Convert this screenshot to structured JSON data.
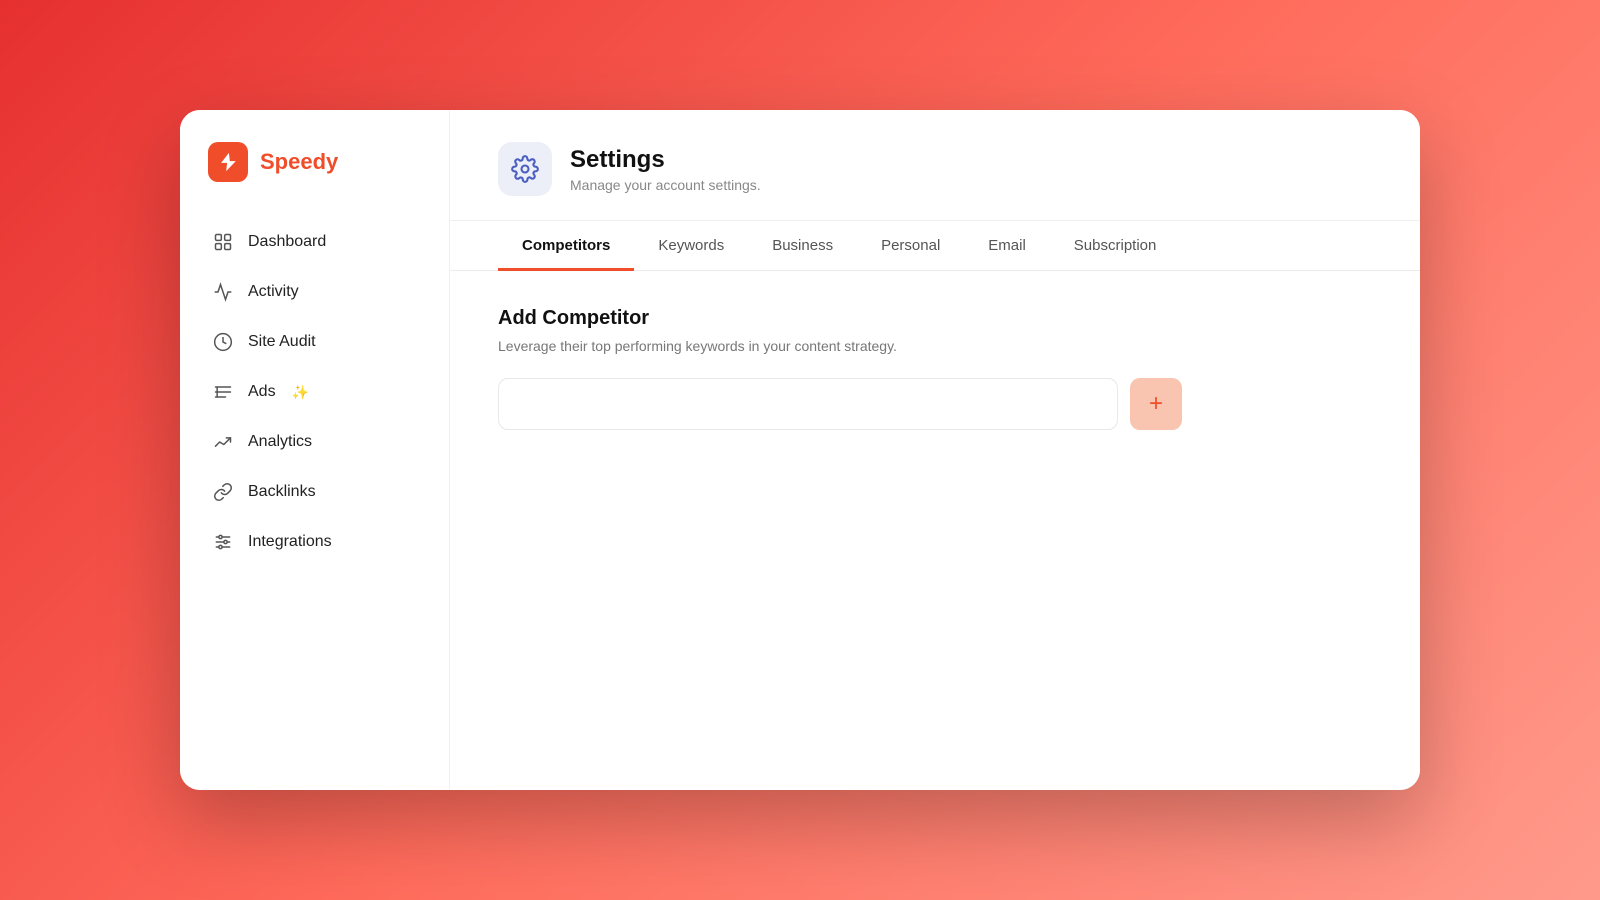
{
  "app": {
    "name": "Speedy",
    "logo_icon": "🚀"
  },
  "sidebar": {
    "nav_items": [
      {
        "id": "dashboard",
        "label": "Dashboard",
        "icon": "dashboard"
      },
      {
        "id": "activity",
        "label": "Activity",
        "icon": "activity"
      },
      {
        "id": "site-audit",
        "label": "Site Audit",
        "icon": "site-audit"
      },
      {
        "id": "ads",
        "label": "Ads",
        "icon": "ads",
        "badge": "✨"
      },
      {
        "id": "analytics",
        "label": "Analytics",
        "icon": "analytics"
      },
      {
        "id": "backlinks",
        "label": "Backlinks",
        "icon": "backlinks"
      },
      {
        "id": "integrations",
        "label": "Integrations",
        "icon": "integrations"
      }
    ]
  },
  "header": {
    "title": "Settings",
    "subtitle": "Manage your account settings."
  },
  "tabs": {
    "items": [
      {
        "id": "competitors",
        "label": "Competitors",
        "active": true
      },
      {
        "id": "keywords",
        "label": "Keywords",
        "active": false
      },
      {
        "id": "business",
        "label": "Business",
        "active": false
      },
      {
        "id": "personal",
        "label": "Personal",
        "active": false
      },
      {
        "id": "email",
        "label": "Email",
        "active": false
      },
      {
        "id": "subscription",
        "label": "Subscription",
        "active": false
      }
    ]
  },
  "competitors_tab": {
    "section_title": "Add Competitor",
    "section_desc": "Leverage their top performing keywords in your content strategy.",
    "input_placeholder": "",
    "add_button_label": "+"
  }
}
